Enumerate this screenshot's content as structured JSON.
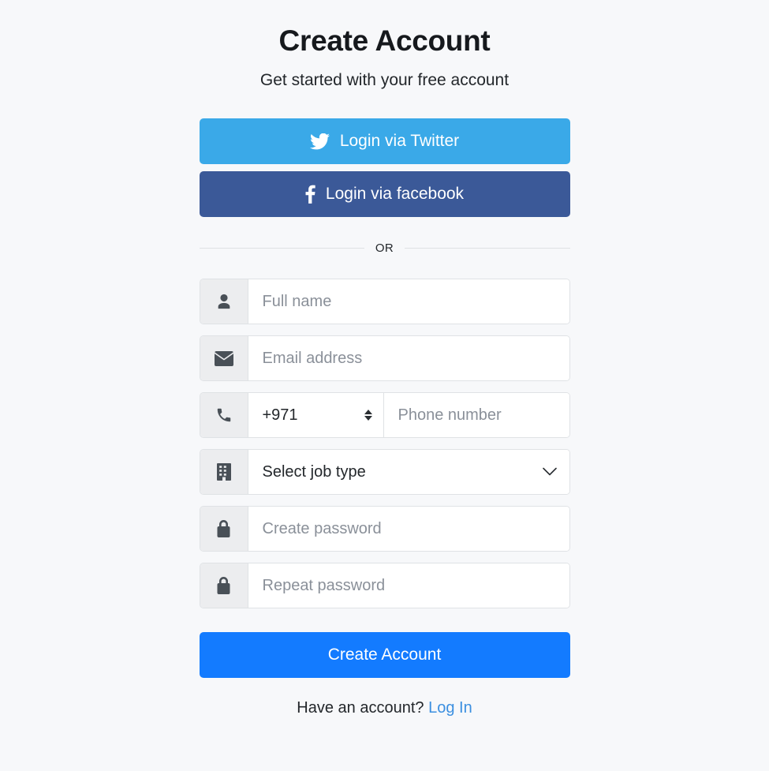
{
  "header": {
    "title": "Create Account",
    "subtitle": "Get started with your free account"
  },
  "social": {
    "twitter": {
      "label": "Login via Twitter",
      "icon": "twitter-bird-icon",
      "color": "#3aa9e8"
    },
    "facebook": {
      "label": "Login via facebook",
      "icon": "facebook-f-icon",
      "color": "#3b5998"
    }
  },
  "divider": {
    "label": "OR"
  },
  "form": {
    "full_name": {
      "placeholder": "Full name",
      "value": "",
      "icon": "user-icon"
    },
    "email": {
      "placeholder": "Email address",
      "value": "",
      "icon": "envelope-icon"
    },
    "phone": {
      "icon": "phone-icon",
      "country_code": "+971",
      "country_options": [
        "+971"
      ],
      "placeholder": "Phone number",
      "value": ""
    },
    "job_type": {
      "icon": "building-icon",
      "selected": "Select job type",
      "options": [
        "Select job type"
      ]
    },
    "password": {
      "placeholder": "Create password",
      "value": "",
      "icon": "lock-icon"
    },
    "password_repeat": {
      "placeholder": "Repeat password",
      "value": "",
      "icon": "lock-icon"
    }
  },
  "submit": {
    "label": "Create Account",
    "color": "#137bff"
  },
  "footer": {
    "text": "Have an account?",
    "link_label": "Log In",
    "link_color": "#3b8fe0"
  }
}
